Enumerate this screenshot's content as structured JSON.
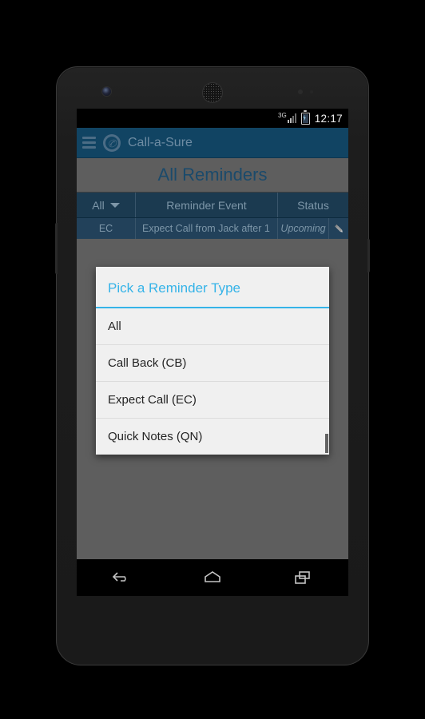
{
  "status_bar": {
    "network_label": "3G",
    "network_icon": "signal-3g-icon",
    "battery_icon": "battery-charging-icon",
    "clock": "12:17"
  },
  "action_bar": {
    "menu_icon": "hamburger-menu-icon",
    "app_icon": "call-a-sure-app-icon",
    "app_title": "Call-a-Sure"
  },
  "page": {
    "title": "All Reminders"
  },
  "table": {
    "headers": {
      "filter": "All",
      "filter_icon": "chevron-down-icon",
      "event": "Reminder Event",
      "status": "Status"
    },
    "rows": [
      {
        "type": "EC",
        "event": "Expect Call from Jack after 1",
        "status": "Upcoming",
        "edit_icon": "pencil-edit-icon"
      }
    ]
  },
  "dialog": {
    "title": "Pick a Reminder Type",
    "options": [
      {
        "label": "All"
      },
      {
        "label": "Call Back (CB)"
      },
      {
        "label": "Expect Call (EC)"
      },
      {
        "label": "Quick Notes (QN)"
      }
    ]
  },
  "nav_bar": {
    "back": "back-icon",
    "home": "home-icon",
    "recents": "recent-apps-icon"
  },
  "colors": {
    "action_bar": "#114463",
    "accent": "#35b3e8",
    "table_header": "#1b3a50",
    "page_title_text": "#1b4a6b",
    "scrim": "#5e5e5e"
  }
}
